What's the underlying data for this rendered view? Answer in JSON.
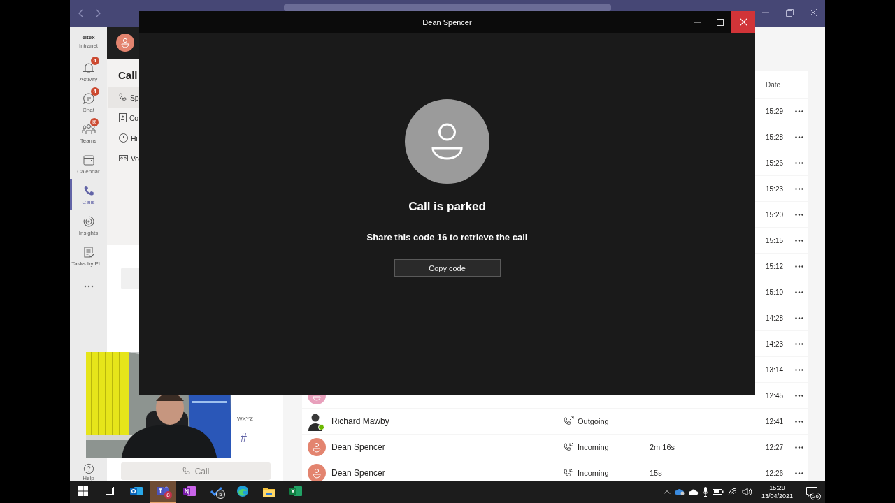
{
  "rail": {
    "logo": {
      "name": "eitex",
      "label": "Intranet"
    },
    "items": [
      {
        "kind": "bell",
        "label": "Activity",
        "badge": "4",
        "selected": false
      },
      {
        "kind": "chat",
        "label": "Chat",
        "badge": "4",
        "selected": false
      },
      {
        "kind": "teams",
        "label": "Teams",
        "badge": "@",
        "selected": false
      },
      {
        "kind": "calendar",
        "label": "Calendar",
        "selected": false
      },
      {
        "kind": "phone",
        "label": "Calls",
        "selected": true
      },
      {
        "kind": "insights",
        "label": "Insights",
        "selected": false
      },
      {
        "kind": "tasks",
        "label": "Tasks by Pl…",
        "selected": false
      }
    ],
    "help": {
      "label": "Help"
    }
  },
  "calls_pane": {
    "heading": "Call",
    "nav": [
      {
        "kind": "phone",
        "label": "Sp",
        "selected": true
      },
      {
        "kind": "contacts",
        "label": "Co",
        "selected": false
      },
      {
        "kind": "history",
        "label": "Hi",
        "selected": false
      },
      {
        "kind": "voicemail",
        "label": "Vo",
        "selected": false
      }
    ],
    "dialpad": {
      "letters": "WXYZ",
      "symbol": "#"
    },
    "call_button": {
      "label": "Call",
      "disabled": true
    }
  },
  "history": {
    "date_header": "Date",
    "rows": [
      {
        "time": "15:29"
      },
      {
        "time": "15:28"
      },
      {
        "time": "15:26"
      },
      {
        "time": "15:23"
      },
      {
        "time": "15:20"
      },
      {
        "time": "15:15"
      },
      {
        "time": "15:12"
      },
      {
        "time": "15:10"
      },
      {
        "time": "14:28"
      },
      {
        "time": "14:23"
      },
      {
        "time": "13:14"
      },
      {
        "avatar": {
          "kind": "default",
          "color": "#e8a0bc"
        },
        "time": "12:45"
      },
      {
        "avatar": {
          "presence": {
            "kind": "available"
          }
        },
        "name": "Richard Mawby",
        "call": {
          "kind": "outgoing",
          "label": "Outgoing"
        },
        "time": "12:41"
      },
      {
        "avatar": {
          "kind": "default",
          "color": "#e3846f"
        },
        "name": "Dean Spencer",
        "call": {
          "kind": "incoming",
          "label": "Incoming"
        },
        "duration": "2m 16s",
        "time": "12:27"
      },
      {
        "avatar": {
          "kind": "default",
          "color": "#e3846f"
        },
        "name": "Dean Spencer",
        "call": {
          "kind": "incoming",
          "label": "Incoming"
        },
        "duration": "15s",
        "time": "12:26"
      }
    ]
  },
  "call_window": {
    "title": "Dean Spencer",
    "status": "Call is parked",
    "message": "Share this code 16 to retrieve the call",
    "button": "Copy code"
  },
  "taskbar": {
    "apps": [
      {
        "kind": "start",
        "selected": false
      },
      {
        "kind": "task-view",
        "selected": false
      },
      {
        "kind": "outlook",
        "selected": false
      },
      {
        "kind": "teams",
        "badge": "8",
        "selected": true
      },
      {
        "kind": "onenote",
        "selected": false
      },
      {
        "kind": "todo",
        "badge": "5",
        "selected": false
      },
      {
        "kind": "edge",
        "selected": false
      },
      {
        "kind": "explorer",
        "selected": false
      },
      {
        "kind": "excel",
        "selected": false
      }
    ],
    "clock": {
      "time": "15:29",
      "date": "13/04/2021"
    },
    "notifications": "26"
  }
}
